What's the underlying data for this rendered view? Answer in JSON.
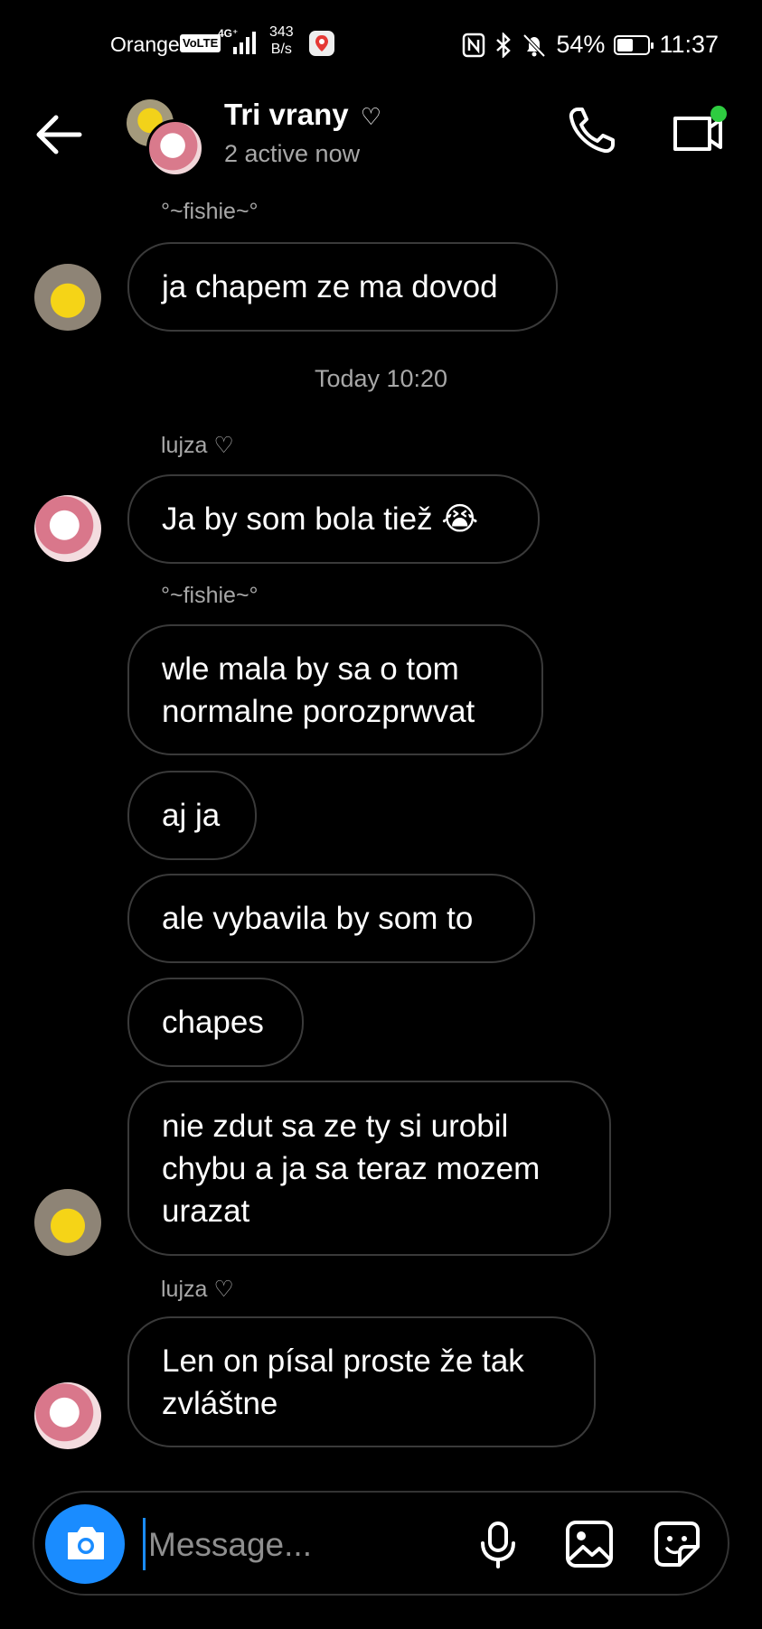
{
  "status_bar": {
    "carrier": "Orange",
    "volte": "VoLTE",
    "network": "4G⁺",
    "speed_value": "343",
    "speed_unit": "B/s",
    "battery": "54%",
    "battery_level": 0.54,
    "time": "11:37"
  },
  "header": {
    "title": "Tri vrany",
    "title_heart": "♡",
    "subtitle": "2 active now"
  },
  "chat": {
    "timestamp": "Today 10:20",
    "messages": [
      {
        "sender": "°~fishie~°",
        "text": "ja chapem ze ma dovod"
      },
      {
        "sender": "lujza ♡",
        "text": "Ja by som bola tiež 😭"
      },
      {
        "sender": "°~fishie~°",
        "text": "wle mala by sa o tom normalne porozprwvat"
      },
      {
        "text": "aj ja"
      },
      {
        "text": "ale vybavila by som to"
      },
      {
        "text": "chapes"
      },
      {
        "text": "nie zdut sa ze ty si urobil chybu a ja sa teraz mozem urazat"
      },
      {
        "sender": "lujza ♡",
        "text": "Len on písal proste že tak zvláštne"
      }
    ]
  },
  "composer": {
    "placeholder": "Message..."
  },
  "colors": {
    "background": "#000000",
    "bubble_border": "#3a3a3a",
    "accent_blue": "#1a8cff",
    "online_green": "#2ecc40",
    "muted_text": "#a8a8a8"
  },
  "icons": [
    "back-arrow-icon",
    "phone-icon",
    "video-call-icon",
    "camera-icon",
    "microphone-icon",
    "gallery-icon",
    "sticker-icon"
  ]
}
